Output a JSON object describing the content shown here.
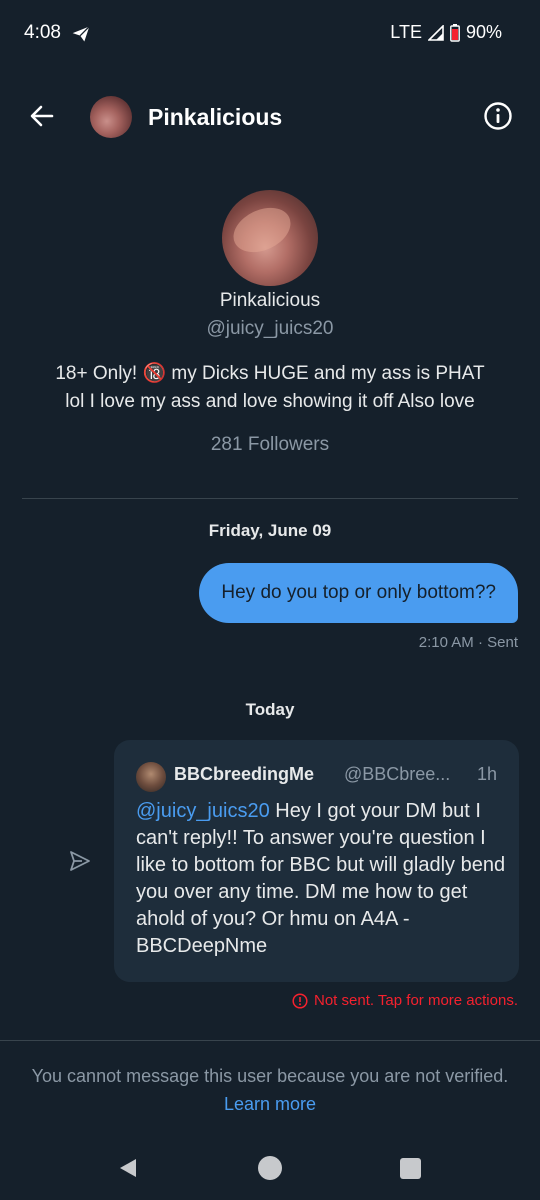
{
  "status_bar": {
    "time": "4:08",
    "network": "LTE",
    "battery": "90%"
  },
  "header": {
    "title": "Pinkalicious"
  },
  "profile": {
    "name": "Pinkalicious",
    "handle": "@juicy_juics20",
    "bio_line1": "18+ Only! 🔞 my Dicks HUGE and my ass is PHAT",
    "bio_line2": "lol I love my ass and love showing it off Also love",
    "followers": "281 Followers"
  },
  "conversation": {
    "date_1": "Friday, June 09",
    "sent_message": "Hey do you top or only bottom??",
    "sent_meta": "2:10 AM · Sent",
    "date_2": "Today",
    "shared_tweet": {
      "author": "BBCbreedingMe",
      "handle": "@BBCbree...",
      "time": "1h",
      "mention": "@juicy_juics20",
      "text": " Hey I got your DM but I can't reply!! To answer you're question I like to bottom for BBC but will gladly bend you over any time. DM me how to get ahold of you? Or hmu on A4A - BBCDeepNme"
    },
    "error": "Not sent. Tap for more actions."
  },
  "footer": {
    "notice": "You cannot message this user because you are not verified.",
    "learn_more": "Learn more"
  },
  "colors": {
    "background": "#15202b",
    "accent": "#4a9cf0",
    "error": "#f4212e",
    "card": "#1e2d3b"
  }
}
